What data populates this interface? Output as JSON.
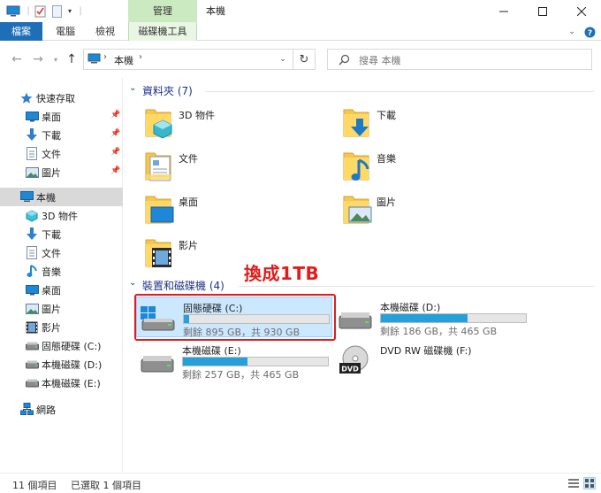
{
  "window": {
    "title": "本機",
    "manage_tab": "管理",
    "buttons": {
      "minimize": "minimize-icon",
      "maximize": "maximize-icon",
      "close": "close-icon"
    }
  },
  "ribbon": {
    "tabs": [
      "檔案",
      "電腦",
      "檢視",
      "磁碟機工具"
    ]
  },
  "address": {
    "location": "本機",
    "search_placeholder": "搜尋 本機"
  },
  "sidebar": {
    "items": [
      {
        "label": "快速存取",
        "icon": "star-icon"
      },
      {
        "label": "桌面",
        "icon": "desktop-icon",
        "pinned": true
      },
      {
        "label": "下載",
        "icon": "download-icon",
        "pinned": true
      },
      {
        "label": "文件",
        "icon": "document-icon",
        "pinned": true
      },
      {
        "label": "圖片",
        "icon": "picture-icon",
        "pinned": true
      },
      {
        "label": "本機",
        "icon": "computer-icon",
        "selected": true
      },
      {
        "label": "3D 物件",
        "icon": "3d-objects-icon"
      },
      {
        "label": "下載",
        "icon": "download-icon"
      },
      {
        "label": "文件",
        "icon": "document-icon"
      },
      {
        "label": "音樂",
        "icon": "music-icon"
      },
      {
        "label": "桌面",
        "icon": "desktop-icon"
      },
      {
        "label": "圖片",
        "icon": "picture-icon"
      },
      {
        "label": "影片",
        "icon": "video-icon"
      },
      {
        "label": "固態硬碟 (C:)",
        "icon": "drive-icon"
      },
      {
        "label": "本機磁碟 (D:)",
        "icon": "drive-icon"
      },
      {
        "label": "本機磁碟 (E:)",
        "icon": "drive-icon"
      },
      {
        "label": "網路",
        "icon": "network-icon"
      }
    ]
  },
  "folders_group": {
    "title": "資料夾 (7)",
    "items": [
      {
        "label": "3D 物件",
        "icon": "3d-objects-folder-icon"
      },
      {
        "label": "下載",
        "icon": "download-folder-icon"
      },
      {
        "label": "文件",
        "icon": "document-folder-icon"
      },
      {
        "label": "音樂",
        "icon": "music-folder-icon"
      },
      {
        "label": "桌面",
        "icon": "desktop-folder-icon"
      },
      {
        "label": "圖片",
        "icon": "picture-folder-icon"
      },
      {
        "label": "影片",
        "icon": "video-folder-icon"
      }
    ]
  },
  "drives_group": {
    "title": "裝置和磁碟機 (4)",
    "items": [
      {
        "name": "固態硬碟 (C:)",
        "space": "剩餘 895 GB，共 930 GB",
        "used_fraction": 0.038,
        "icon": "windows-drive-icon",
        "selected": true
      },
      {
        "name": "本機磁碟 (D:)",
        "space": "剩餘 186 GB，共 465 GB",
        "used_fraction": 0.6,
        "icon": "drive-icon"
      },
      {
        "name": "本機磁碟 (E:)",
        "space": "剩餘 257 GB，共 465 GB",
        "used_fraction": 0.447,
        "icon": "drive-icon"
      },
      {
        "name": "DVD RW 磁碟機 (F:)",
        "icon": "dvd-drive-icon"
      }
    ]
  },
  "annotation": {
    "text": "換成1TB",
    "color": "#e31b1b"
  },
  "status": {
    "count": "11 個項目",
    "selected": "已選取 1 個項目"
  },
  "colors": {
    "accent": "#1e6fb7",
    "selected_bg": "#cce8ff",
    "drive_fill": "#26a0da",
    "manage_tab": "#cbeac1"
  }
}
